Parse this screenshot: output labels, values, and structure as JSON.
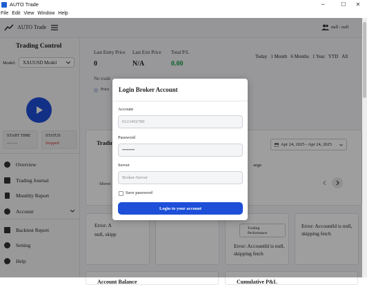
{
  "window": {
    "title": "AUTO Trade",
    "controls": {
      "minimize": "─",
      "maximize": "☐",
      "close": "✕"
    }
  },
  "menu": [
    "File",
    "Edit",
    "View",
    "Window",
    "Help"
  ],
  "topbar": {
    "logo_text": "AUTO Trade",
    "user": "null : null"
  },
  "sidebar": {
    "heading": "Trading Control",
    "model_label": "Model:",
    "model_value": "XAUUSD Model",
    "start_time_label": "START TIME",
    "start_time_value": "--:--:--",
    "status_label": "STATUS",
    "status_value": "Stopped",
    "nav": [
      {
        "label": "Overview",
        "icon": "pie-chart-icon"
      },
      {
        "label": "Trading Journal",
        "icon": "book-icon"
      },
      {
        "label": "Monthly Report",
        "icon": "document-icon"
      },
      {
        "label": "Account",
        "icon": "user-icon"
      },
      {
        "label": "Backtest Report",
        "icon": "report-icon"
      },
      {
        "label": "Setting",
        "icon": "gear-icon"
      },
      {
        "label": "Help",
        "icon": "help-icon"
      }
    ]
  },
  "summary": {
    "last_entry_label": "Last Entry Price",
    "last_entry_value": "0",
    "last_exit_label": "Last Exit Price",
    "last_exit_value": "N/A",
    "total_pl_label": "Total P/L",
    "total_pl_value": "0.00",
    "no_trades_text": "No trade",
    "price_chk_label": "Price",
    "ranges": [
      "Today",
      "1 Month",
      "6 Months",
      "1 Year",
      "YTD",
      "All"
    ]
  },
  "trading_section": {
    "title_partial": "Tradin",
    "date_range": "Apr 24, 2025 - Apr 24, 2025",
    "range_text": "ange",
    "showing_partial": "Showi",
    "performance_text": "Trading\nPerformance"
  },
  "errors": {
    "card1_line1": "Error: A",
    "card1_line2": "null, skipp",
    "card3": "Error: AccountId is null, skipping fetch",
    "card4": "Error: AccountId is null, skipping fetch"
  },
  "bottom": {
    "account_balance": "Account Balance",
    "cumulative_pl": "Cumulative P&L"
  },
  "modal": {
    "title": "Login Broker Account",
    "account_label": "Account",
    "account_placeholder": "0123456789",
    "password_label": "Password",
    "password_value": "••••••••",
    "server_label": "Server",
    "server_placeholder": "Broker-Server",
    "save_password_label": "Save password",
    "login_button": "Login to your account"
  },
  "colors": {
    "accent": "#1d4fd8",
    "play_button": "#1d4fd8",
    "profit_green": "#1e9e4a",
    "status_red": "#d93025"
  }
}
